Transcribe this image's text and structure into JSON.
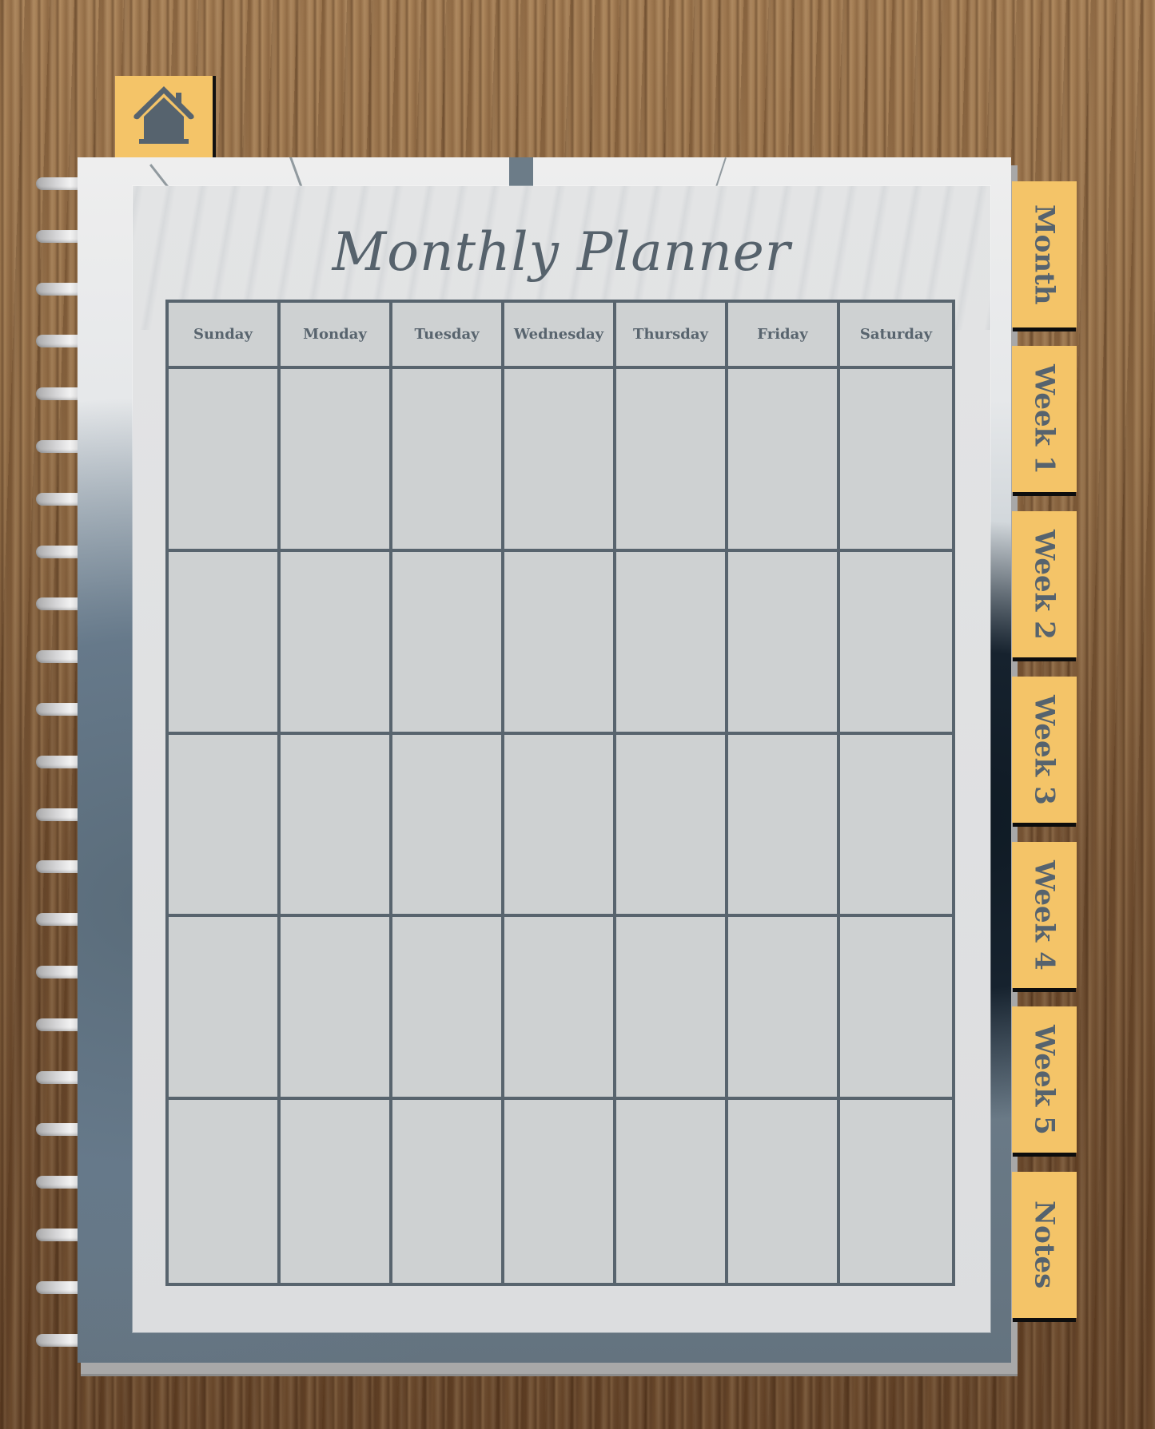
{
  "title": "Monthly Planner",
  "home_tab": {
    "icon": "home-icon",
    "label": "Home"
  },
  "weekdays": [
    "Sunday",
    "Monday",
    "Tuesday",
    "Wednesday",
    "Thursday",
    "Friday",
    "Saturday"
  ],
  "weeks_rows": 5,
  "side_tabs": [
    {
      "label": "Month"
    },
    {
      "label": "Week 1"
    },
    {
      "label": "Week 2"
    },
    {
      "label": "Week 3"
    },
    {
      "label": "Week 4"
    },
    {
      "label": "Week 5"
    },
    {
      "label": "Notes"
    }
  ],
  "colors": {
    "tab": "#f4c468",
    "ink": "#56626c",
    "grid_line": "#58646e",
    "cell": "#ced1d2",
    "panel": "#dcdddf"
  }
}
